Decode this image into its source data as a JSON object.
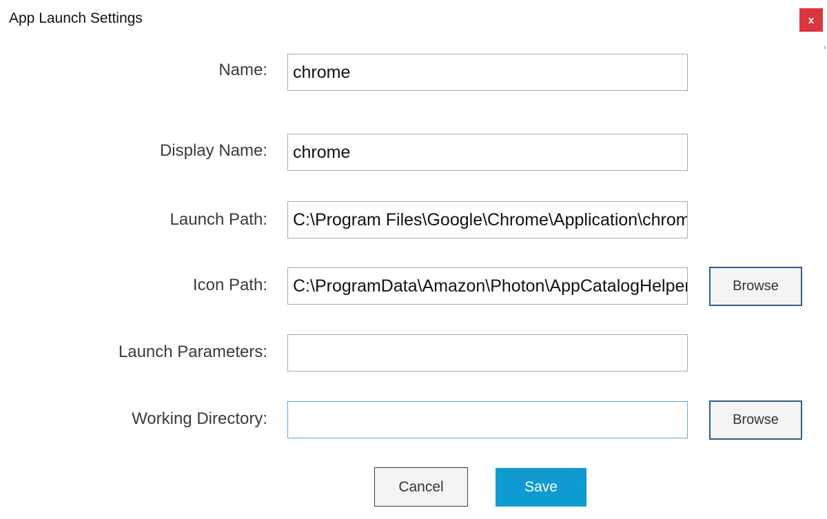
{
  "dialog": {
    "title": "App Launch Settings",
    "close_label": "x"
  },
  "form": {
    "name": {
      "label": "Name:",
      "value": "chrome"
    },
    "display_name": {
      "label": "Display Name:",
      "value": "chrome"
    },
    "launch_path": {
      "label": "Launch Path:",
      "value": "C:\\Program Files\\Google\\Chrome\\Application\\chrome.exe"
    },
    "icon_path": {
      "label": "Icon Path:",
      "value": "C:\\ProgramData\\Amazon\\Photon\\AppCatalogHelper"
    },
    "launch_parameters": {
      "label": "Launch Parameters:",
      "value": ""
    },
    "working_directory": {
      "label": "Working Directory:",
      "value": ""
    }
  },
  "buttons": {
    "browse_icon": "Browse",
    "browse_working_dir": "Browse",
    "cancel": "Cancel",
    "save": "Save"
  },
  "colors": {
    "close_bg": "#d9373d",
    "save_bg": "#0f9bd2",
    "browse_border": "#2f5d86",
    "focus_border": "#5aa9da"
  }
}
